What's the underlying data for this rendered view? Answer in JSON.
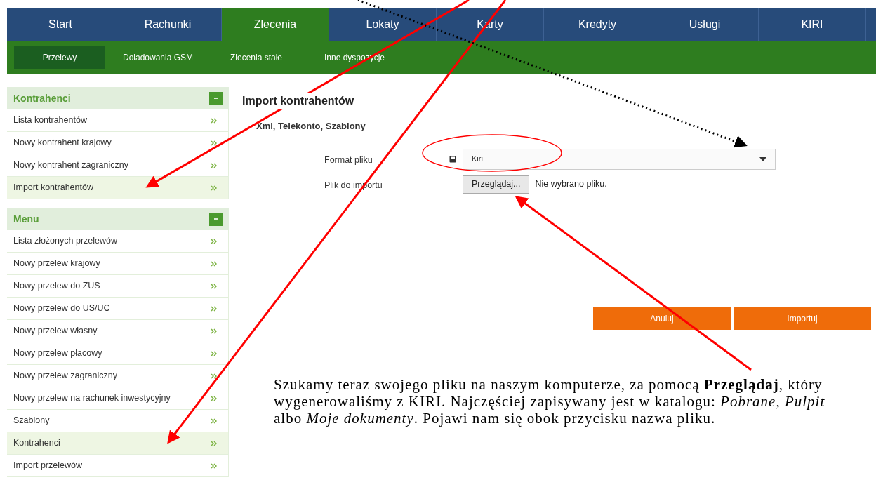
{
  "nav": {
    "tabs": [
      {
        "label": "Start",
        "selected": false
      },
      {
        "label": "Rachunki",
        "selected": false
      },
      {
        "label": "Zlecenia",
        "selected": true
      },
      {
        "label": "Lokaty",
        "selected": false
      },
      {
        "label": "Karty",
        "selected": false
      },
      {
        "label": "Kredyty",
        "selected": false
      },
      {
        "label": "Usługi",
        "selected": false
      },
      {
        "label": "KIRI",
        "selected": false
      }
    ],
    "subtabs": [
      {
        "label": "Przelewy",
        "selected": true
      },
      {
        "label": "Doładowania GSM",
        "selected": false
      },
      {
        "label": "Zlecenia stałe",
        "selected": false
      },
      {
        "label": "Inne dyspozycje",
        "selected": false
      }
    ]
  },
  "sidebar": {
    "sections": [
      {
        "title": "Kontrahenci",
        "expanded": true,
        "items": [
          {
            "label": "Lista kontrahentów",
            "selected": false
          },
          {
            "label": "Nowy kontrahent krajowy",
            "selected": false
          },
          {
            "label": "Nowy kontrahent zagraniczny",
            "selected": false
          },
          {
            "label": "Import kontrahentów",
            "selected": true
          }
        ]
      },
      {
        "title": "Menu",
        "expanded": true,
        "items": [
          {
            "label": "Lista złożonych przelewów",
            "selected": false
          },
          {
            "label": "Nowy przelew krajowy",
            "selected": false
          },
          {
            "label": "Nowy przelew do ZUS",
            "selected": false
          },
          {
            "label": "Nowy przelew do US/UC",
            "selected": false
          },
          {
            "label": "Nowy przelew własny",
            "selected": false
          },
          {
            "label": "Nowy przelew płacowy",
            "selected": false
          },
          {
            "label": "Nowy przelew zagraniczny",
            "selected": false
          },
          {
            "label": "Nowy przelew na rachunek inwestycyjny",
            "selected": false
          },
          {
            "label": "Szablony",
            "selected": false
          },
          {
            "label": "Kontrahenci",
            "selected": true
          },
          {
            "label": "Import przelewów",
            "selected": false
          }
        ]
      }
    ]
  },
  "form": {
    "title": "Import kontrahentów",
    "subtitle": "Xml, Telekonto, Szablony",
    "format_label": "Format pliku",
    "format_value": "Kiri",
    "file_label": "Plik do importu",
    "browse_button": "Przeglądaj...",
    "file_status": "Nie wybrano pliku.",
    "buttons": [
      "Anuluj",
      "Importuj"
    ]
  },
  "note": "Szukamy teraz swojego pliku na naszym komputerze, za pomocą **Przeglądaj**, który wygenerowaliśmy z KIRI. Najczęściej zapisywany jest w katalogu: *Pobrane, Pulpit* albo *Moje dokumenty*. Pojawi nam się obok przycisku nazwa pliku."
}
